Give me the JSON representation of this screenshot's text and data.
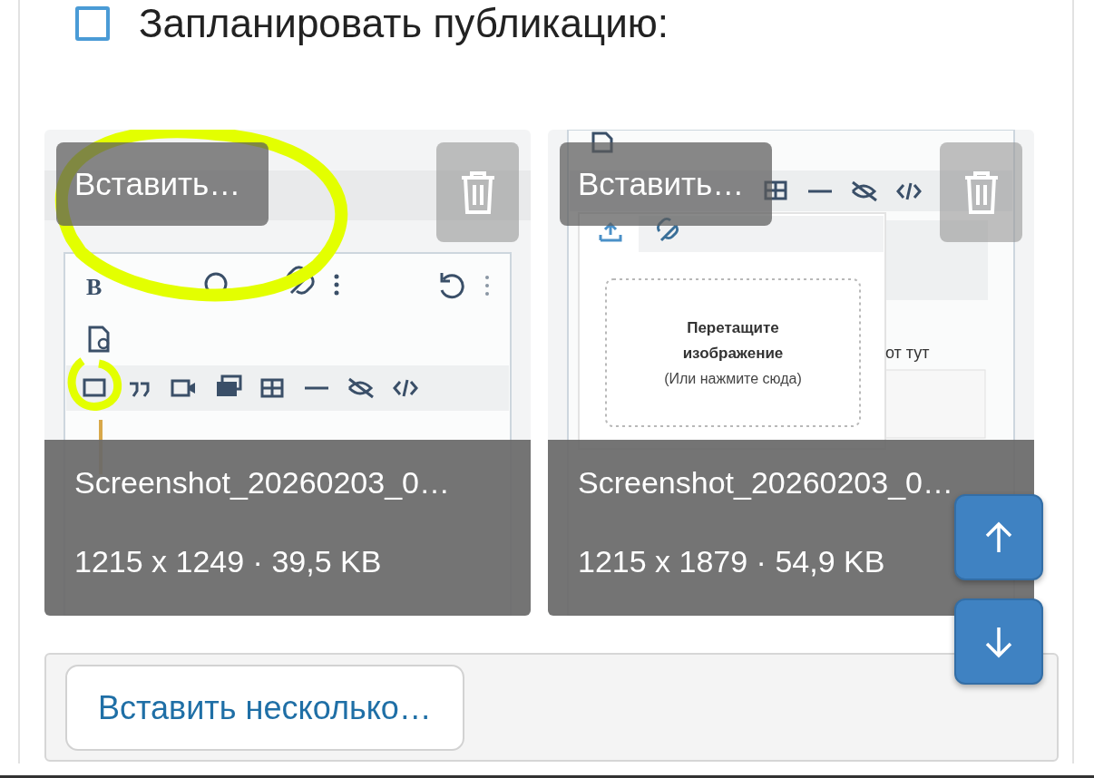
{
  "schedule": {
    "label": "Запланировать публикацию:",
    "checked": false
  },
  "attachments": [
    {
      "insert_label": "Вставить…",
      "filename": "Screenshot_20260203_0…",
      "details": "1215 x 1249 · 39,5 KB",
      "kind": "editor_toolbar",
      "preview_texts": {
        "bold_button": "B"
      }
    },
    {
      "insert_label": "Вставить…",
      "filename": "Screenshot_20260203_0…",
      "details": "1215 x 1879 · 54,9 KB",
      "kind": "upload_dialog",
      "preview_texts": {
        "drop_title_1": "Перетащите",
        "drop_title_2": "изображение",
        "drop_hint": "(Или нажмите сюда)",
        "side_text": "от тут"
      }
    }
  ],
  "insert_multiple": "Вставить несколько…"
}
